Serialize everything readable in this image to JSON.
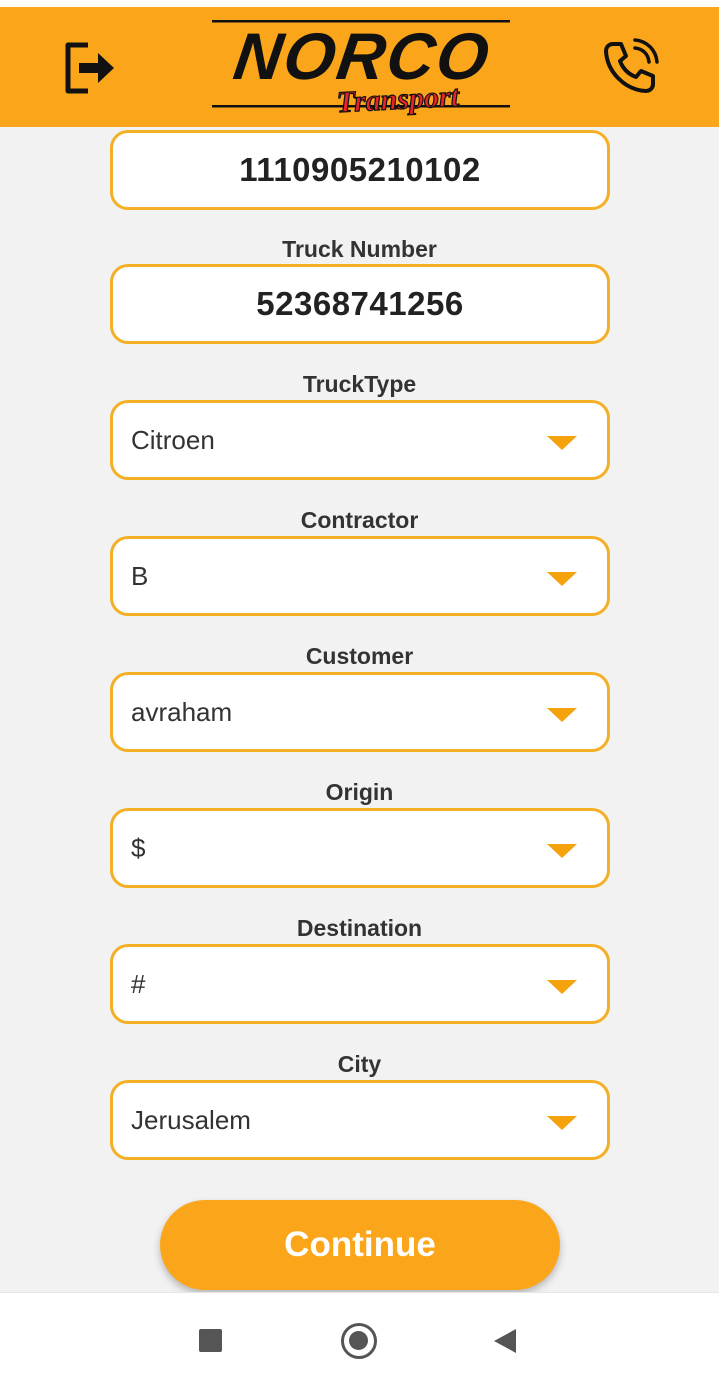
{
  "app": {
    "brand": "NORCO",
    "brand_sub": "Transport",
    "colors": {
      "accent": "#fba61a",
      "border": "#f3b024",
      "caret": "#f4a20e",
      "logo_red": "#e8232b"
    }
  },
  "header": {
    "logout_icon": "logout-icon",
    "phone_icon": "phone-icon"
  },
  "form": {
    "id_value": "1110905210102",
    "truck_number_label": "Truck Number",
    "truck_number_value": "52368741256",
    "truck_type_label": "TruckType",
    "truck_type_value": "Citroen",
    "contractor_label": "Contractor",
    "contractor_value": "B",
    "customer_label": "Customer",
    "customer_value": "avraham",
    "origin_label": "Origin",
    "origin_value": "$",
    "destination_label": "Destination",
    "destination_value": "#",
    "city_label": "City",
    "city_value": "Jerusalem",
    "continue_label": "Continue"
  },
  "navbar": {
    "icons": [
      "recents-icon",
      "home-icon",
      "back-icon"
    ]
  }
}
